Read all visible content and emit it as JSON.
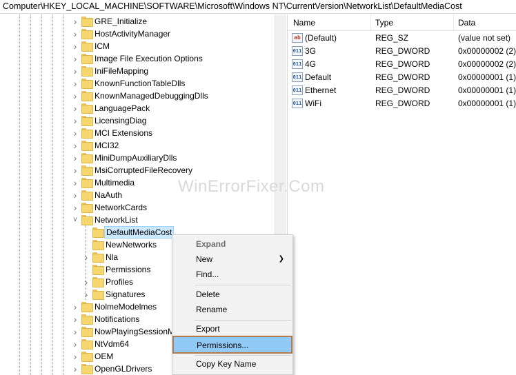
{
  "address_bar": {
    "path": "Computer\\HKEY_LOCAL_MACHINE\\SOFTWARE\\Microsoft\\Windows NT\\CurrentVersion\\NetworkList\\DefaultMediaCost"
  },
  "tree": {
    "items": [
      {
        "label": "GRE_Initialize",
        "expanded": false
      },
      {
        "label": "HostActivityManager",
        "expanded": false
      },
      {
        "label": "ICM",
        "expanded": false
      },
      {
        "label": "Image File Execution Options",
        "expanded": false
      },
      {
        "label": "IniFileMapping",
        "expanded": false
      },
      {
        "label": "KnownFunctionTableDlls",
        "expanded": false
      },
      {
        "label": "KnownManagedDebuggingDlls",
        "expanded": false
      },
      {
        "label": "LanguagePack",
        "expanded": false
      },
      {
        "label": "LicensingDiag",
        "expanded": false
      },
      {
        "label": "MCI Extensions",
        "expanded": false
      },
      {
        "label": "MCI32",
        "expanded": false
      },
      {
        "label": "MiniDumpAuxiliaryDlls",
        "expanded": false
      },
      {
        "label": "MsiCorruptedFileRecovery",
        "expanded": false
      },
      {
        "label": "Multimedia",
        "expanded": false
      },
      {
        "label": "NaAuth",
        "expanded": false
      },
      {
        "label": "NetworkCards",
        "expanded": false
      },
      {
        "label": "NetworkList",
        "expanded": true
      },
      {
        "label": "DefaultMediaCost",
        "selected": true
      },
      {
        "label": "NewNetworks"
      },
      {
        "label": "Nla",
        "expanded": false
      },
      {
        "label": "Permissions"
      },
      {
        "label": "Profiles",
        "expanded": false
      },
      {
        "label": "Signatures",
        "expanded": false
      },
      {
        "label": "NolmeModelmes",
        "expanded": false
      },
      {
        "label": "Notifications",
        "expanded": false
      },
      {
        "label": "NowPlayingSessionM",
        "expanded": false
      },
      {
        "label": "NtVdm64",
        "expanded": false
      },
      {
        "label": "OEM",
        "expanded": false
      },
      {
        "label": "OpenGLDrivers",
        "expanded": false
      }
    ]
  },
  "list": {
    "columns": {
      "name": "Name",
      "type": "Type",
      "data": "Data"
    },
    "rows": [
      {
        "name": "(Default)",
        "type": "REG_SZ",
        "data": "(value not set)",
        "icon": "string-value-icon",
        "icon_text": "ab"
      },
      {
        "name": "3G",
        "type": "REG_DWORD",
        "data": "0x00000002 (2)",
        "icon": "binary-value-icon",
        "icon_text": "011"
      },
      {
        "name": "4G",
        "type": "REG_DWORD",
        "data": "0x00000002 (2)",
        "icon": "binary-value-icon",
        "icon_text": "011"
      },
      {
        "name": "Default",
        "type": "REG_DWORD",
        "data": "0x00000001 (1)",
        "icon": "binary-value-icon",
        "icon_text": "011"
      },
      {
        "name": "Ethernet",
        "type": "REG_DWORD",
        "data": "0x00000001 (1)",
        "icon": "binary-value-icon",
        "icon_text": "011"
      },
      {
        "name": "WiFi",
        "type": "REG_DWORD",
        "data": "0x00000001 (1)",
        "icon": "binary-value-icon",
        "icon_text": "011"
      }
    ]
  },
  "watermark": {
    "text": "WinErrorFixer.Com"
  },
  "context_menu": {
    "expand": "Expand",
    "new": "New",
    "find": "Find...",
    "delete": "Delete",
    "rename": "Rename",
    "export": "Export",
    "permissions": "Permissions...",
    "copy_key_name": "Copy Key Name"
  },
  "colors": {
    "selection_bg": "#cce8ff",
    "menu_highlight": "#91c9f7",
    "highlight_outline": "#b07b4f",
    "folder": "#f6d66e"
  }
}
